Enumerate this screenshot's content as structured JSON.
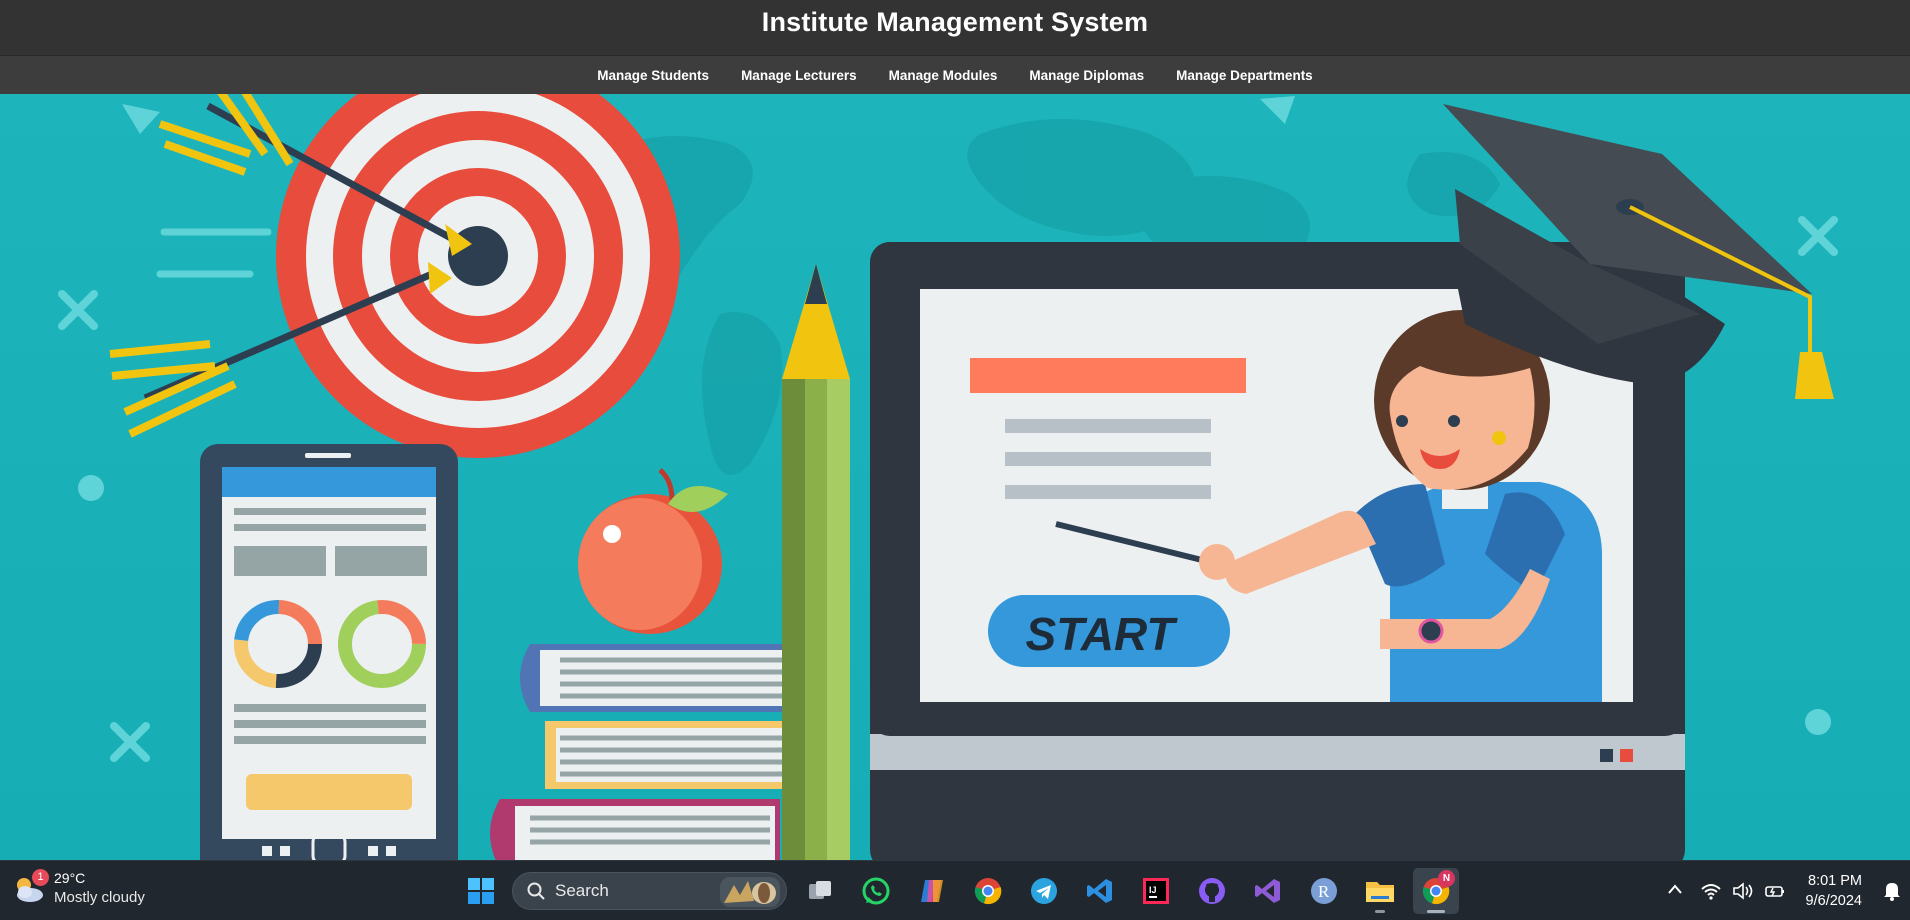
{
  "header": {
    "title": "Institute Management System"
  },
  "nav": {
    "items": [
      {
        "label": "Manage Students"
      },
      {
        "label": "Manage Lecturers"
      },
      {
        "label": "Manage Modules"
      },
      {
        "label": "Manage Diplomas"
      },
      {
        "label": "Manage Departments"
      }
    ]
  },
  "hero": {
    "start_label": "START",
    "colors": {
      "background": "#1db4bb",
      "target_red": "#e84c3d",
      "screen": "#ecf0f1",
      "start_button": "#3498db"
    }
  },
  "taskbar": {
    "weather": {
      "badge": "1",
      "temp": "29°C",
      "condition": "Mostly cloudy"
    },
    "search": {
      "label": "Search"
    },
    "apps": [
      {
        "name": "task-view-icon"
      },
      {
        "name": "whatsapp-icon"
      },
      {
        "name": "copilot-icon"
      },
      {
        "name": "chrome-icon"
      },
      {
        "name": "telegram-icon"
      },
      {
        "name": "vscode-icon"
      },
      {
        "name": "intellij-icon"
      },
      {
        "name": "github-icon"
      },
      {
        "name": "visual-studio-icon"
      },
      {
        "name": "r-icon"
      },
      {
        "name": "file-explorer-icon"
      },
      {
        "name": "chrome-profile-icon",
        "badge": "N"
      }
    ],
    "clock": {
      "time": "8:01 PM",
      "date": "9/6/2024"
    }
  }
}
